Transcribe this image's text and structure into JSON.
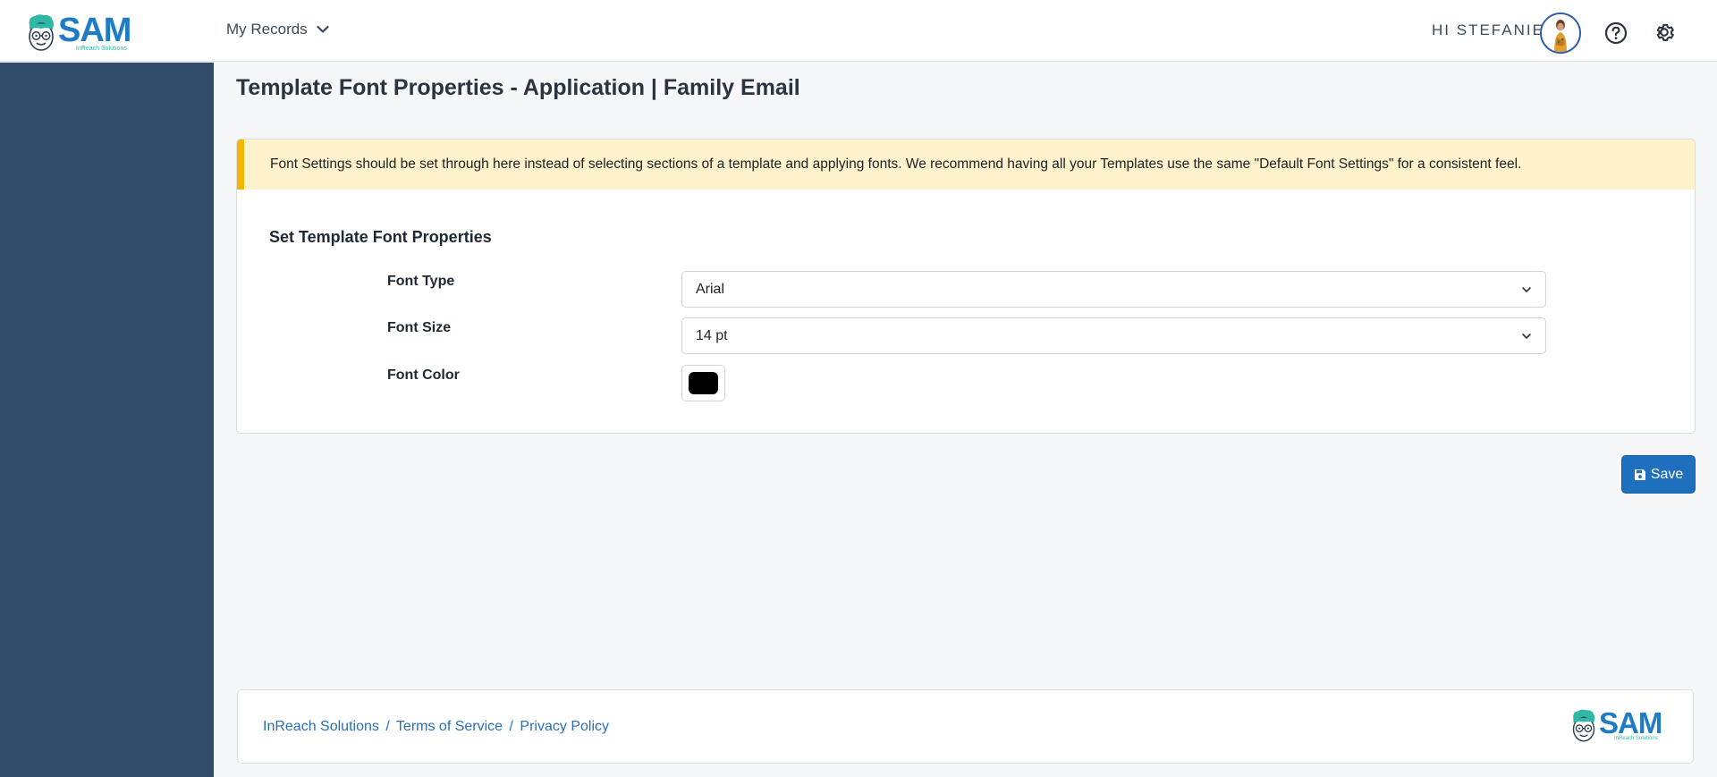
{
  "header": {
    "logo_text": "SAM",
    "logo_subtitle": "InReach Solutions",
    "nav_records_label": "My Records",
    "greeting": "HI STEFANIE"
  },
  "page": {
    "title": "Template Font Properties - Application | Family Email"
  },
  "alert": {
    "message": "Font Settings should be set through here instead of selecting sections of a template and applying fonts. We recommend having all your Templates use the same \"Default Font Settings\" for a consistent feel."
  },
  "form": {
    "section_title": "Set Template Font Properties",
    "font_type_label": "Font Type",
    "font_type_value": "Arial",
    "font_size_label": "Font Size",
    "font_size_value": "14 pt",
    "font_color_label": "Font Color",
    "font_color_value": "#000000"
  },
  "actions": {
    "save_label": "Save"
  },
  "footer": {
    "company_link": "InReach Solutions",
    "terms_link": "Terms of Service",
    "privacy_link": "Privacy Policy",
    "separator": "/"
  },
  "colors": {
    "brand_blue": "#1f7cc4",
    "brand_teal": "#2fb8a6",
    "sidebar": "#324b6b",
    "alert_bg": "#fdf2cb",
    "alert_accent": "#f2b705",
    "primary_button": "#1f6fbf"
  }
}
